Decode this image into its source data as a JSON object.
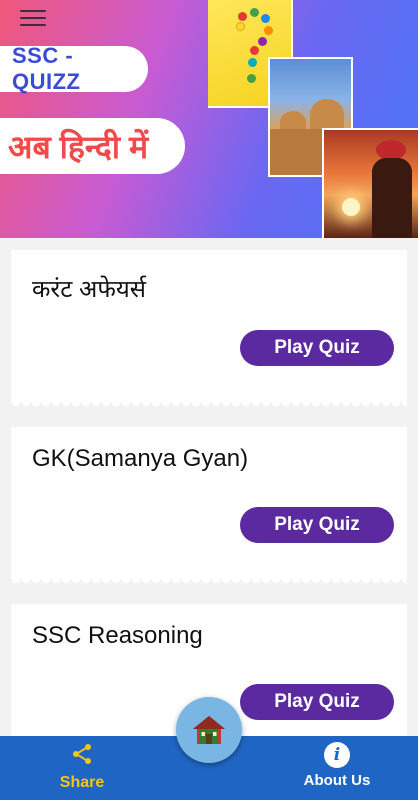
{
  "banner": {
    "title_pill": "SSC - QUIZZ",
    "subtitle_pill": "अब हिन्दी में"
  },
  "cards": [
    {
      "title": "करंट अफेयर्स",
      "button": "Play Quiz"
    },
    {
      "title": "GK(Samanya Gyan)",
      "button": "Play Quiz"
    },
    {
      "title": "SSC Reasoning",
      "button": "Play Quiz"
    }
  ],
  "bottom_nav": {
    "share_label": "Share",
    "about_label": "About Us",
    "about_icon_glyph": "i"
  },
  "icons": {
    "menu": "hamburger-icon",
    "share": "share-icon",
    "info": "info-icon",
    "home": "home-icon"
  },
  "colors": {
    "button_purple": "#5b2aa0",
    "nav_blue": "#1f66c4",
    "share_yellow": "#f5c518",
    "fab_blue": "#7ab6e4",
    "title_blue": "#3a4bd8",
    "hindi_red": "#f24a4a"
  }
}
